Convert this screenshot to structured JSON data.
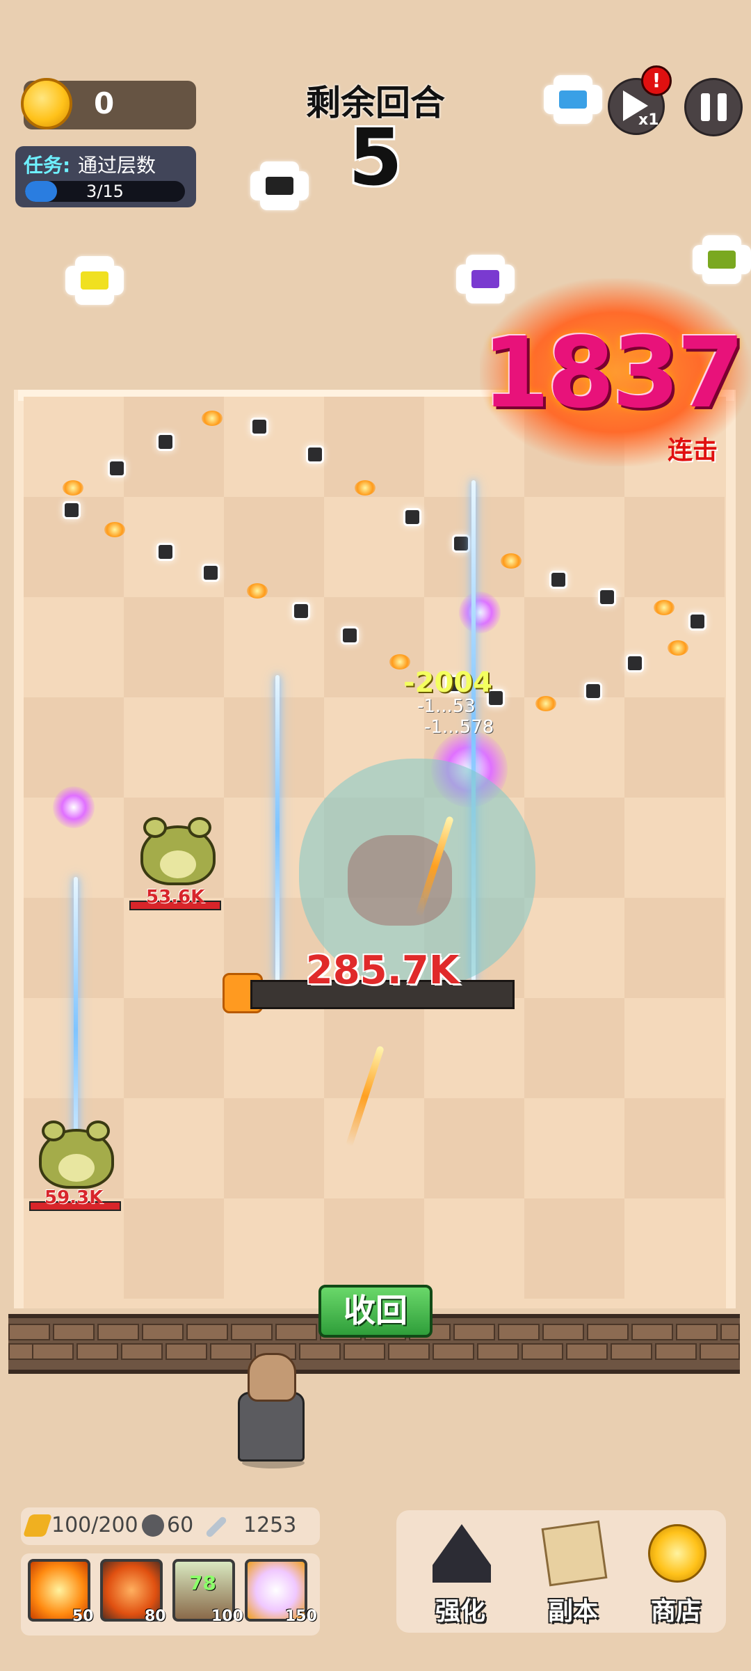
{
  "hud": {
    "coins": "0",
    "task_prefix": "任务:",
    "task_text": "通过层数",
    "task_progress_text": "3/15",
    "task_progress_fraction": 0.2,
    "rounds_label": "剩余回合",
    "rounds_value": "5",
    "speed_label": "x1",
    "alert": "!"
  },
  "combo": {
    "value": "1837",
    "label": "连击"
  },
  "enemies": [
    {
      "name": "frog",
      "hp_text": "53.6K"
    },
    {
      "name": "frog",
      "hp_text": "59.3K"
    }
  ],
  "boss": {
    "hp_text": "285.7K"
  },
  "damage_popup": "-2004",
  "damage_small": [
    "-1...53",
    "-1...578"
  ],
  "recall_button": "收回",
  "stats": {
    "energy": "100/200",
    "stones": "60",
    "attack": "1253"
  },
  "skills": [
    {
      "icon": "explosion-skill-icon",
      "cost": "50",
      "level": ""
    },
    {
      "icon": "fire-beast-skill-icon",
      "cost": "80",
      "level": ""
    },
    {
      "icon": "spike-skill-icon",
      "cost": "100",
      "level": "78"
    },
    {
      "icon": "angel-skill-icon",
      "cost": "150",
      "level": ""
    }
  ],
  "menu": {
    "upgrade": "强化",
    "dungeon": "副本",
    "shop": "商店"
  },
  "colors": {
    "accent_combo": "#e8127a",
    "hp_red": "#d8252a",
    "button_green": "#2f9e3a"
  }
}
